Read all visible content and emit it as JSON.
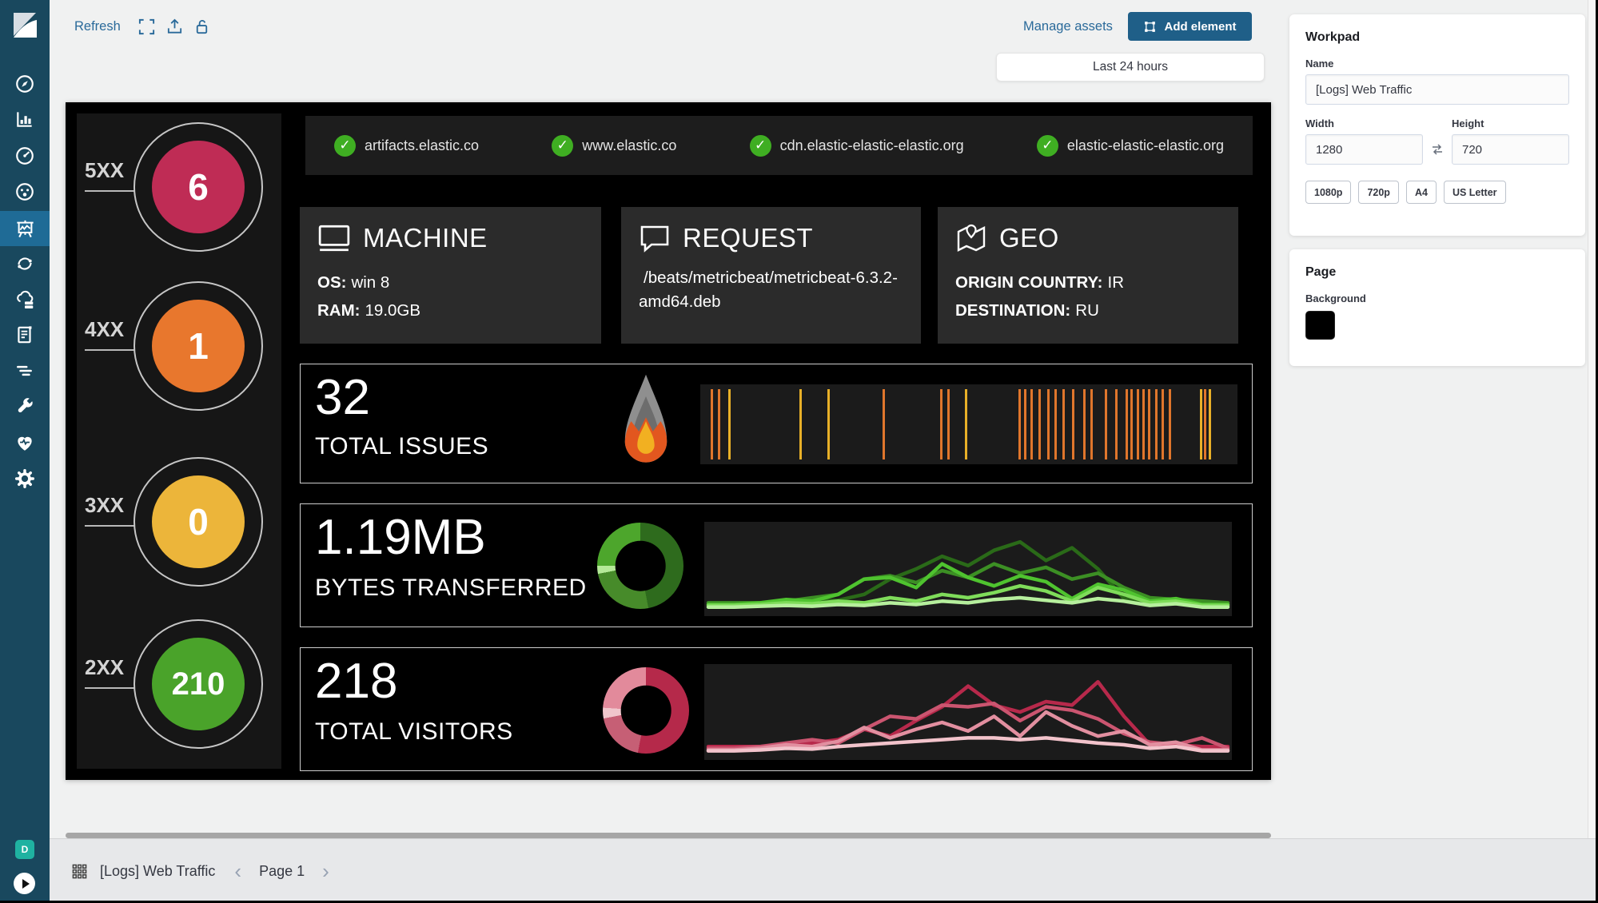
{
  "toolbar": {
    "refresh": "Refresh",
    "manage_assets": "Manage assets",
    "add_element": "Add element",
    "time_filter": "Last 24 hours"
  },
  "sidebar": {
    "space_initial": "D",
    "items": [
      {
        "icon": "discover"
      },
      {
        "icon": "visualize"
      },
      {
        "icon": "dashboard"
      },
      {
        "icon": "machine-learning"
      },
      {
        "icon": "canvas",
        "active": true
      },
      {
        "icon": "code"
      },
      {
        "icon": "infrastructure"
      },
      {
        "icon": "logs"
      },
      {
        "icon": "uptime"
      },
      {
        "icon": "dev-tools"
      },
      {
        "icon": "monitoring"
      },
      {
        "icon": "management"
      }
    ]
  },
  "footer": {
    "workpad_title": "[Logs] Web Traffic",
    "prev": "‹",
    "page": "Page 1",
    "next": "›"
  },
  "panel": {
    "workpad": {
      "heading": "Workpad",
      "name_label": "Name",
      "name_value": "[Logs] Web Traffic",
      "width_label": "Width",
      "width_value": "1280",
      "height_label": "Height",
      "height_value": "720",
      "presets": [
        "1080p",
        "720p",
        "A4",
        "US Letter"
      ]
    },
    "page": {
      "heading": "Page",
      "background_label": "Background",
      "background_color": "#000000"
    }
  },
  "workpad": {
    "status": [
      {
        "label": "5XX",
        "value": "6",
        "color": "#bf2c55"
      },
      {
        "label": "4XX",
        "value": "1",
        "color": "#e8772d"
      },
      {
        "label": "3XX",
        "value": "0",
        "color": "#ecb53a"
      },
      {
        "label": "2XX",
        "value": "210",
        "color": "#4aa32a"
      }
    ],
    "domains": [
      "artifacts.elastic.co",
      "www.elastic.co",
      "cdn.elastic-elastic-elastic.org",
      "elastic-elastic-elastic.org"
    ],
    "cards": [
      {
        "icon": "monitor",
        "title": "MACHINE",
        "lines": [
          {
            "label": "OS:",
            "value": "win 8"
          },
          {
            "label": "RAM:",
            "value": "19.0GB"
          }
        ]
      },
      {
        "icon": "speech-bubble",
        "title": "REQUEST",
        "lines": [
          {
            "label": "",
            "value": "/beats/metricbeat/metricbeat-6.3.2-amd64.deb"
          }
        ]
      },
      {
        "icon": "map-pin",
        "title": "GEO",
        "lines": [
          {
            "label": "ORIGIN COUNTRY:",
            "value": "IR"
          },
          {
            "label": "DESTINATION:",
            "value": "RU"
          }
        ]
      }
    ],
    "rows": [
      {
        "metric": "32",
        "label": "TOTAL ISSUES"
      },
      {
        "metric": "1.19MB",
        "label": "BYTES TRANSFERRED"
      },
      {
        "metric": "218",
        "label": "TOTAL VISITORS"
      }
    ]
  },
  "chart_data": {
    "issues_rug": {
      "type": "rug",
      "total_issues": 32,
      "tick_colors": {
        "o": "#e0762c",
        "y": "#e8b028"
      },
      "ticks": [
        [
          0.02,
          "o"
        ],
        [
          0.033,
          "o"
        ],
        [
          0.052,
          "y"
        ],
        [
          0.185,
          "y"
        ],
        [
          0.237,
          "y"
        ],
        [
          0.34,
          "o"
        ],
        [
          0.447,
          "o"
        ],
        [
          0.46,
          "o"
        ],
        [
          0.492,
          "y"
        ],
        [
          0.592,
          "o"
        ],
        [
          0.602,
          "o"
        ],
        [
          0.614,
          "o"
        ],
        [
          0.629,
          "o"
        ],
        [
          0.646,
          "o"
        ],
        [
          0.659,
          "o"
        ],
        [
          0.674,
          "o"
        ],
        [
          0.692,
          "o"
        ],
        [
          0.713,
          "o"
        ],
        [
          0.726,
          "o"
        ],
        [
          0.753,
          "o"
        ],
        [
          0.773,
          "o"
        ],
        [
          0.792,
          "o"
        ],
        [
          0.801,
          "o"
        ],
        [
          0.813,
          "o"
        ],
        [
          0.823,
          "o"
        ],
        [
          0.833,
          "o"
        ],
        [
          0.846,
          "o"
        ],
        [
          0.859,
          "o"
        ],
        [
          0.872,
          "o"
        ],
        [
          0.93,
          "y"
        ],
        [
          0.938,
          "o"
        ],
        [
          0.946,
          "y"
        ]
      ]
    },
    "bytes_donut": {
      "type": "pie",
      "segments": [
        {
          "color": "#2e6b1d",
          "pct": 47
        },
        {
          "color": "#478b2a",
          "pct": 25
        },
        {
          "color": "#b5e998",
          "pct": 3
        },
        {
          "color": "#4da62c",
          "pct": 25
        }
      ]
    },
    "bytes_lines": {
      "type": "line",
      "y_is_fraction_from_top": true,
      "series": [
        {
          "name": "green-darkest",
          "color": "#2a6a18",
          "values": [
            0.9,
            0.9,
            0.9,
            0.89,
            0.88,
            0.87,
            0.8,
            0.62,
            0.5,
            0.35,
            0.46,
            0.28,
            0.18,
            0.4,
            0.25,
            0.5,
            0.85,
            0.9,
            0.9,
            0.9,
            0.9
          ]
        },
        {
          "name": "green-dark",
          "color": "#3c8f24",
          "values": [
            0.9,
            0.9,
            0.9,
            0.88,
            0.84,
            0.8,
            0.62,
            0.58,
            0.66,
            0.52,
            0.6,
            0.44,
            0.55,
            0.48,
            0.62,
            0.55,
            0.72,
            0.84,
            0.86,
            0.88,
            0.9
          ]
        },
        {
          "name": "green-bright",
          "color": "#4fc32f",
          "values": [
            0.92,
            0.92,
            0.9,
            0.86,
            0.88,
            0.8,
            0.62,
            0.6,
            0.72,
            0.44,
            0.6,
            0.7,
            0.58,
            0.65,
            0.85,
            0.68,
            0.75,
            0.88,
            0.85,
            0.92,
            0.92
          ]
        },
        {
          "name": "green-light",
          "color": "#7fdc5a",
          "values": [
            0.93,
            0.93,
            0.92,
            0.9,
            0.91,
            0.88,
            0.9,
            0.84,
            0.88,
            0.8,
            0.84,
            0.78,
            0.7,
            0.76,
            0.88,
            0.72,
            0.8,
            0.9,
            0.88,
            0.93,
            0.93
          ]
        },
        {
          "name": "green-pale",
          "color": "#b6ef9d",
          "values": [
            0.95,
            0.95,
            0.94,
            0.93,
            0.94,
            0.92,
            0.93,
            0.9,
            0.92,
            0.88,
            0.9,
            0.86,
            0.84,
            0.87,
            0.9,
            0.85,
            0.88,
            0.93,
            0.91,
            0.95,
            0.95
          ]
        }
      ]
    },
    "visitors_donut": {
      "type": "pie",
      "segments": [
        {
          "color": "#b5294a",
          "pct": 53
        },
        {
          "color": "#c65f75",
          "pct": 19
        },
        {
          "color": "#f0c6cc",
          "pct": 4
        },
        {
          "color": "#e28a9b",
          "pct": 24
        }
      ]
    },
    "visitors_lines": {
      "type": "line",
      "y_is_fraction_from_top": true,
      "series": [
        {
          "name": "pink-darkest",
          "color": "#b7294b",
          "values": [
            0.9,
            0.9,
            0.9,
            0.88,
            0.86,
            0.82,
            0.7,
            0.78,
            0.6,
            0.44,
            0.2,
            0.42,
            0.5,
            0.38,
            0.42,
            0.15,
            0.55,
            0.88,
            0.88,
            0.9,
            0.9
          ]
        },
        {
          "name": "pink-med",
          "color": "#cb5570",
          "values": [
            0.92,
            0.92,
            0.9,
            0.86,
            0.82,
            0.86,
            0.7,
            0.55,
            0.58,
            0.42,
            0.44,
            0.4,
            0.6,
            0.44,
            0.48,
            0.58,
            0.75,
            0.85,
            0.88,
            0.8,
            0.92
          ]
        },
        {
          "name": "pink-light",
          "color": "#e28fa0",
          "values": [
            0.94,
            0.94,
            0.92,
            0.88,
            0.9,
            0.84,
            0.68,
            0.8,
            0.7,
            0.62,
            0.72,
            0.55,
            0.78,
            0.5,
            0.66,
            0.78,
            0.72,
            0.88,
            0.85,
            0.94,
            0.94
          ]
        },
        {
          "name": "pink-pale",
          "color": "#f2c3cb",
          "values": [
            0.95,
            0.95,
            0.94,
            0.92,
            0.93,
            0.9,
            0.88,
            0.86,
            0.84,
            0.82,
            0.8,
            0.8,
            0.82,
            0.8,
            0.83,
            0.86,
            0.88,
            0.92,
            0.9,
            0.95,
            0.95
          ]
        }
      ]
    }
  }
}
